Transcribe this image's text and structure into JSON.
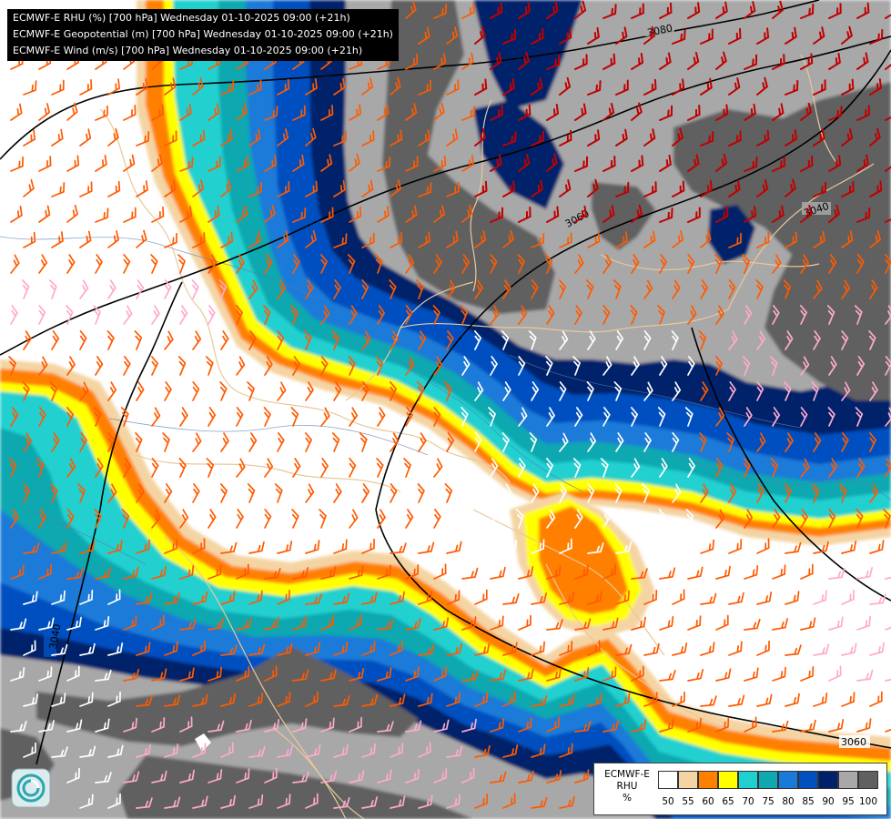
{
  "header": {
    "line1": "ECMWF-E RHU (%) [700 hPa] Wednesday 01-10-2025 09:00 (+21h)",
    "line2": "ECMWF-E Geopotential (m) [700 hPa] Wednesday 01-10-2025 09:00 (+21h)",
    "line3": "ECMWF-E Wind (m/s) [700 hPa] Wednesday 01-10-2025 09:00 (+21h)"
  },
  "contours": {
    "labels": [
      "3080",
      "3060",
      "3040",
      "3040",
      "3060"
    ]
  },
  "legend": {
    "title_line1": "ECMWF-E",
    "title_line2": "RHU",
    "title_line3": "%",
    "ticks": [
      "50",
      "55",
      "60",
      "65",
      "70",
      "75",
      "80",
      "85",
      "90",
      "95",
      "100"
    ],
    "colors": [
      "#ffffff",
      "#f5d4a3",
      "#ff8000",
      "#ffff00",
      "#20d0d0",
      "#10a8b0",
      "#1a7ad8",
      "#0050c0",
      "#00206a",
      "#a8a8a8",
      "#606060"
    ]
  },
  "palette": {
    "wind_orange": "#ff5a00",
    "wind_red": "#c00000",
    "wind_pink": "#ffaacc",
    "wind_white": "#ffffff",
    "contour": "#000000",
    "border": "#e8c89a",
    "river": "#5a7ab0"
  },
  "logo": "ecmwf-logo-icon"
}
